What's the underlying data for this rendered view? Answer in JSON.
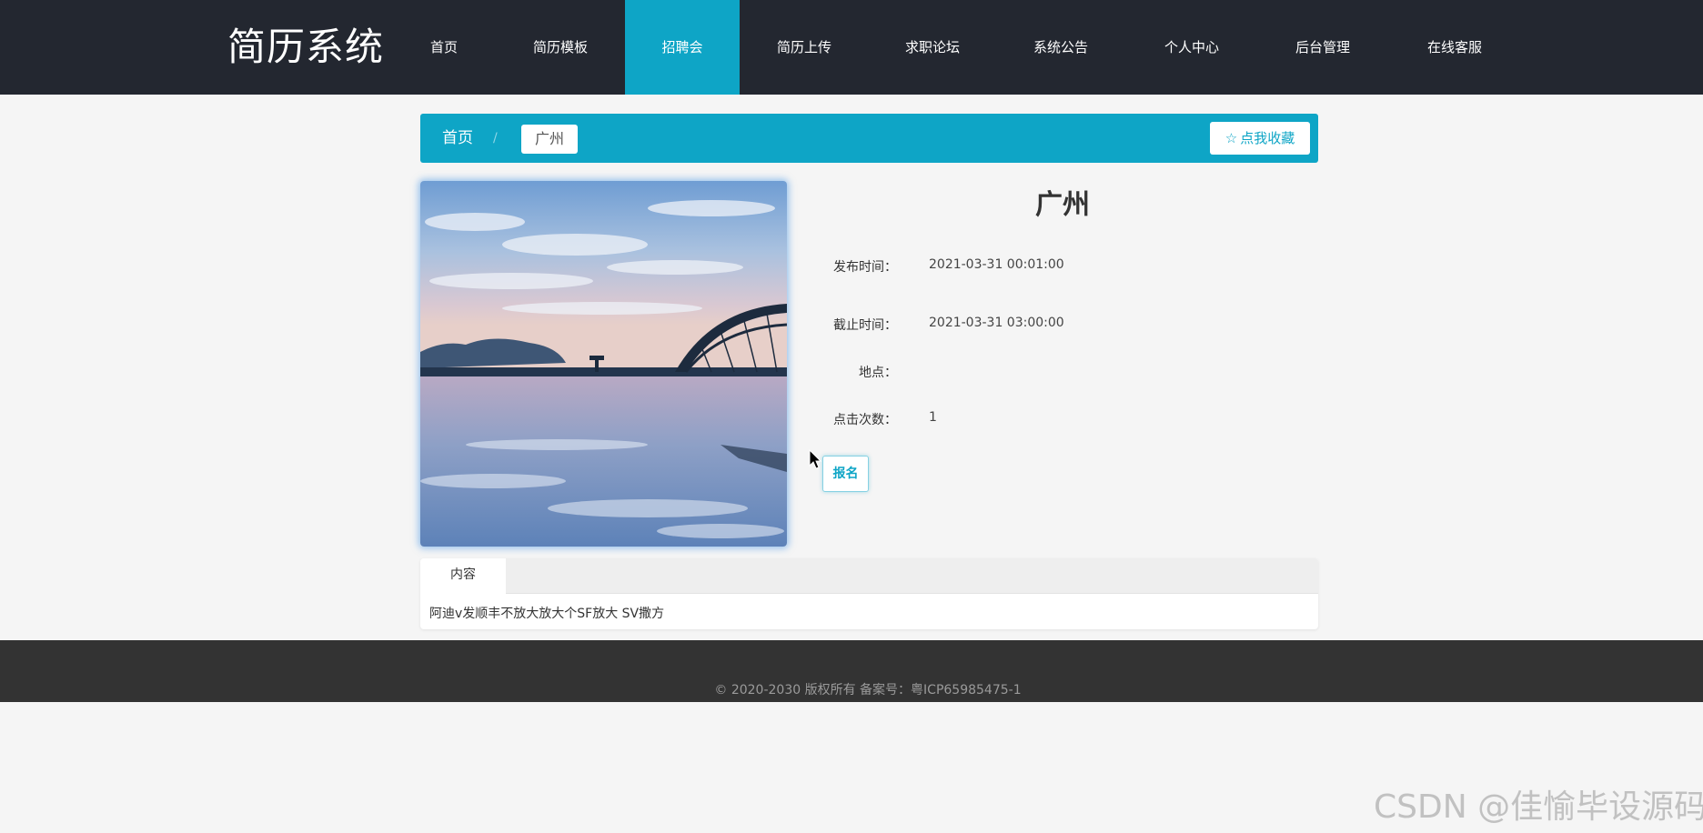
{
  "header": {
    "logo": "简历系统",
    "nav": [
      {
        "label": "首页",
        "active": false
      },
      {
        "label": "简历模板",
        "active": false
      },
      {
        "label": "招聘会",
        "active": true
      },
      {
        "label": "简历上传",
        "active": false
      },
      {
        "label": "求职论坛",
        "active": false
      },
      {
        "label": "系统公告",
        "active": false
      },
      {
        "label": "个人中心",
        "active": false
      },
      {
        "label": "后台管理",
        "active": false
      },
      {
        "label": "在线客服",
        "active": false
      }
    ]
  },
  "breadcrumb": {
    "home": "首页",
    "separator": "/",
    "current": "广州",
    "favorite_label": "点我收藏"
  },
  "detail": {
    "title": "广州",
    "fields": [
      {
        "label": "发布时间：",
        "value": "2021-03-31 00:01:00"
      },
      {
        "label": "截止时间：",
        "value": "2021-03-31 03:00:00"
      },
      {
        "label": "地点：",
        "value": ""
      },
      {
        "label": "点击次数：",
        "value": "1"
      }
    ],
    "signup_label": "报名"
  },
  "tabs": {
    "active_label": "内容",
    "content": "阿迪v发顺丰不放大放大个SF放大 SV撒方"
  },
  "footer": {
    "copyright": "© 2020-2030 版权所有 备案号：粤ICP65985475-1"
  },
  "watermark": "CSDN @佳愉毕设源码",
  "colors": {
    "header_bg": "#232730",
    "accent": "#0ea5c6",
    "page_bg": "#f5f5f5",
    "footer_bg": "#333333"
  }
}
